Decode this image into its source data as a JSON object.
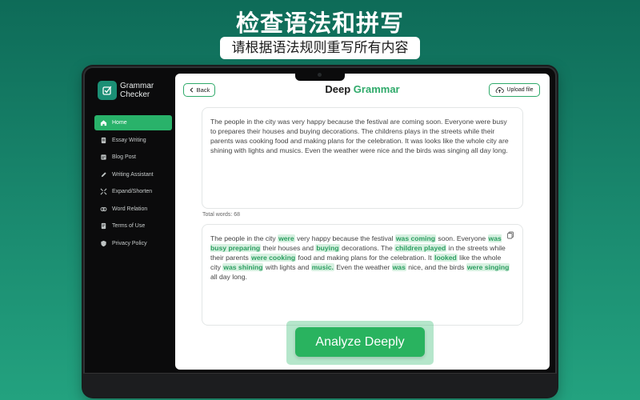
{
  "promo": {
    "title": "检查语法和拼写",
    "subtitle": "请根据语法规则重写所有内容"
  },
  "app": {
    "name_line1": "Grammar",
    "name_line2": "Checker",
    "accent_color": "#29b26a"
  },
  "sidebar": {
    "items": [
      {
        "label": "Home",
        "icon": "home-icon",
        "active": true
      },
      {
        "label": "Essay Writing",
        "icon": "document-icon",
        "active": false
      },
      {
        "label": "Blog Post",
        "icon": "blog-icon",
        "active": false
      },
      {
        "label": "Writing Assistant",
        "icon": "pen-icon",
        "active": false
      },
      {
        "label": "Expand/Shorten",
        "icon": "expand-icon",
        "active": false
      },
      {
        "label": "Word Relation",
        "icon": "link-icon",
        "active": false
      },
      {
        "label": "Terms of Use",
        "icon": "terms-icon",
        "active": false
      },
      {
        "label": "Privacy Policy",
        "icon": "shield-icon",
        "active": false
      }
    ]
  },
  "header": {
    "back_label": "Back",
    "title_part1": "Deep",
    "title_part2": "Grammar",
    "upload_label": "Upload file"
  },
  "input": {
    "text": "The people in the city was very happy because the festival are coming soon. Everyone were busy to prepares their houses and buying decorations. The childrens plays in the streets while their parents was cooking food and making plans for the celebration. It was looks like the whole city are shining with lights and musics. Even the weather were nice and the birds was singing all day long.",
    "word_count_label": "Total words: 68"
  },
  "output": {
    "segments": [
      {
        "t": "The people in the city ",
        "h": false
      },
      {
        "t": "were",
        "h": true
      },
      {
        "t": " very happy because the festival ",
        "h": false
      },
      {
        "t": "was coming",
        "h": true
      },
      {
        "t": " soon. Everyone ",
        "h": false
      },
      {
        "t": "was busy preparing",
        "h": true
      },
      {
        "t": " their houses and ",
        "h": false
      },
      {
        "t": "buying",
        "h": true
      },
      {
        "t": " decorations. The ",
        "h": false
      },
      {
        "t": "children played",
        "h": true
      },
      {
        "t": " in the streets while their parents ",
        "h": false
      },
      {
        "t": "were cooking",
        "h": true
      },
      {
        "t": " food and making plans for the celebration. It ",
        "h": false
      },
      {
        "t": "looked",
        "h": true
      },
      {
        "t": " like the whole city ",
        "h": false
      },
      {
        "t": "was shining",
        "h": true
      },
      {
        "t": " with lights and ",
        "h": false
      },
      {
        "t": "music.",
        "h": true
      },
      {
        "t": " Even the weather ",
        "h": false
      },
      {
        "t": "was",
        "h": true
      },
      {
        "t": " nice, and the birds ",
        "h": false
      },
      {
        "t": "were singing",
        "h": true
      },
      {
        "t": " all day long.",
        "h": false
      }
    ]
  },
  "actions": {
    "analyze_label": "Analyze Deeply"
  }
}
